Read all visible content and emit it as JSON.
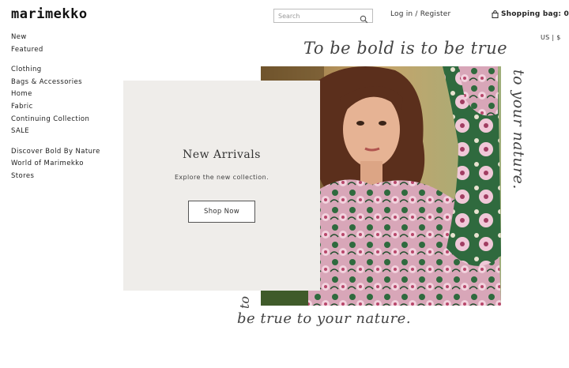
{
  "brand": {
    "logo": "marimekko"
  },
  "header": {
    "search_placeholder": "Search",
    "search_icon": "magnifier-icon",
    "login_label": "Log in / Register",
    "bag_label": "Shopping bag: 0",
    "bag_icon": "shopping-bag-icon"
  },
  "region": {
    "label": "US | $"
  },
  "nav": {
    "group1": [
      "New",
      "Featured"
    ],
    "group2": [
      "Clothing",
      "Bags & Accessories",
      "Home",
      "Fabric",
      "Continuing Collection",
      "SALE"
    ],
    "group3": [
      "Discover Bold By Nature",
      "World of Marimekko",
      "Stores"
    ]
  },
  "promo": {
    "title": "New Arrivals",
    "subtitle": "Explore the new collection.",
    "cta_label": "Shop Now"
  },
  "hero": {
    "script_top": "To be bold is to be true",
    "script_right": "to your nature.",
    "script_bottom": "be true to your nature.",
    "script_left": "to"
  },
  "colors": {
    "promo_bg": "#efedea",
    "text": "#222222",
    "dress_pink": "#e7a9c4",
    "dress_green": "#2f6a3e"
  }
}
